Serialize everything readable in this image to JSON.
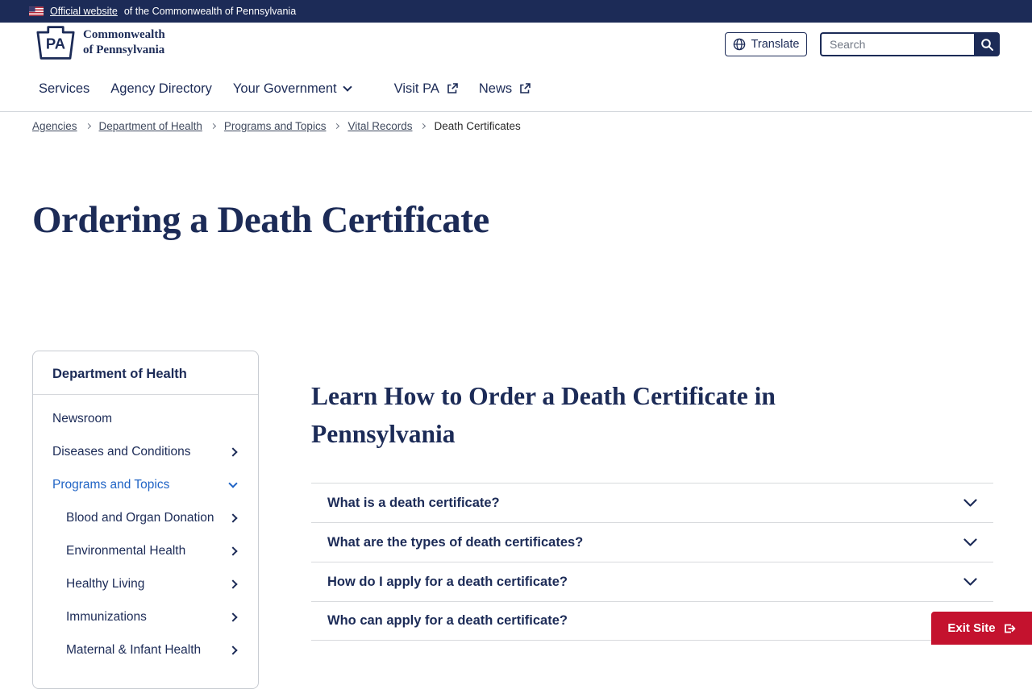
{
  "banner": {
    "link_text": "Official website",
    "rest_text": "of the Commonwealth of Pennsylvania"
  },
  "header": {
    "logo_line1": "Commonwealth",
    "logo_line2": "of Pennsylvania",
    "logo_mark": "PA",
    "translate_label": "Translate",
    "search_placeholder": "Search"
  },
  "nav": {
    "items": [
      {
        "label": "Services"
      },
      {
        "label": "Agency Directory"
      },
      {
        "label": "Your Government"
      },
      {
        "label": "Visit PA"
      },
      {
        "label": "News"
      }
    ]
  },
  "breadcrumb": {
    "items": [
      {
        "label": "Agencies"
      },
      {
        "label": "Department of Health"
      },
      {
        "label": "Programs and Topics"
      },
      {
        "label": "Vital Records"
      },
      {
        "label": "Death Certificates"
      }
    ]
  },
  "page": {
    "title": "Ordering a Death Certificate"
  },
  "sidebar": {
    "title": "Department of Health",
    "items": [
      {
        "label": "Newsroom"
      },
      {
        "label": "Diseases and Conditions"
      },
      {
        "label": "Programs and Topics"
      },
      {
        "label": "Blood and Organ Donation"
      },
      {
        "label": "Environmental Health"
      },
      {
        "label": "Healthy Living"
      },
      {
        "label": "Immunizations"
      },
      {
        "label": "Maternal & Infant Health"
      }
    ]
  },
  "main": {
    "heading": "Learn How to Order a Death Certificate in Pennsylvania",
    "accordions": [
      {
        "question": "What is a death certificate?"
      },
      {
        "question": "What are the types of death certificates?"
      },
      {
        "question": "How do I apply for a death certificate?"
      },
      {
        "question": "Who can apply for a death certificate?"
      }
    ]
  },
  "exit": {
    "label": "Exit Site"
  },
  "colors": {
    "navy": "#1C2B57",
    "accent_blue": "#2064C5",
    "exit_red": "#C4122E",
    "border_gray": "#D6D8DC"
  }
}
